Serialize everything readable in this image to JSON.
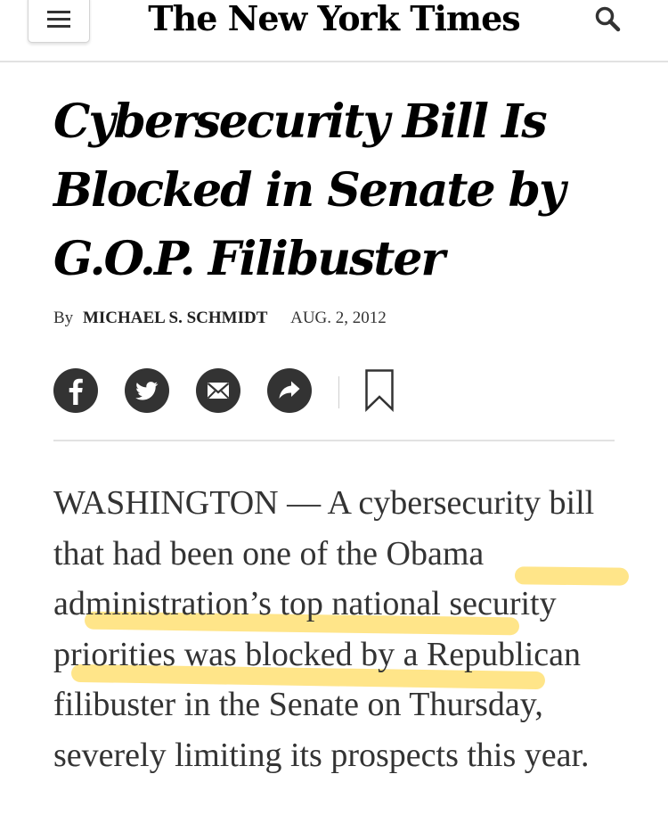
{
  "header": {
    "masthead": "The New York Times",
    "menu_icon": "hamburger-menu-icon",
    "search_icon": "search-icon"
  },
  "article": {
    "headline": "Cybersecurity Bill Is Blocked in Senate by G.O.P. Filibuster",
    "byline_prefix": "By",
    "author": "MICHAEL S. SCHMIDT",
    "date": "AUG. 2, 2012",
    "body": "WASHINGTON — A cybersecurity bill that had been one of the Obama administration’s top national security priorities was blocked by a Republican filibuster in the Senate on Thursday, severely limiting its prospects this year."
  },
  "share": {
    "buttons": [
      "facebook-icon",
      "twitter-icon",
      "email-icon",
      "share-arrow-icon"
    ],
    "bookmark": "bookmark-icon"
  },
  "colors": {
    "icon_fill": "#333333",
    "highlight": "#FFD028",
    "rule": "#E2E2E2",
    "body_text": "#333333"
  }
}
